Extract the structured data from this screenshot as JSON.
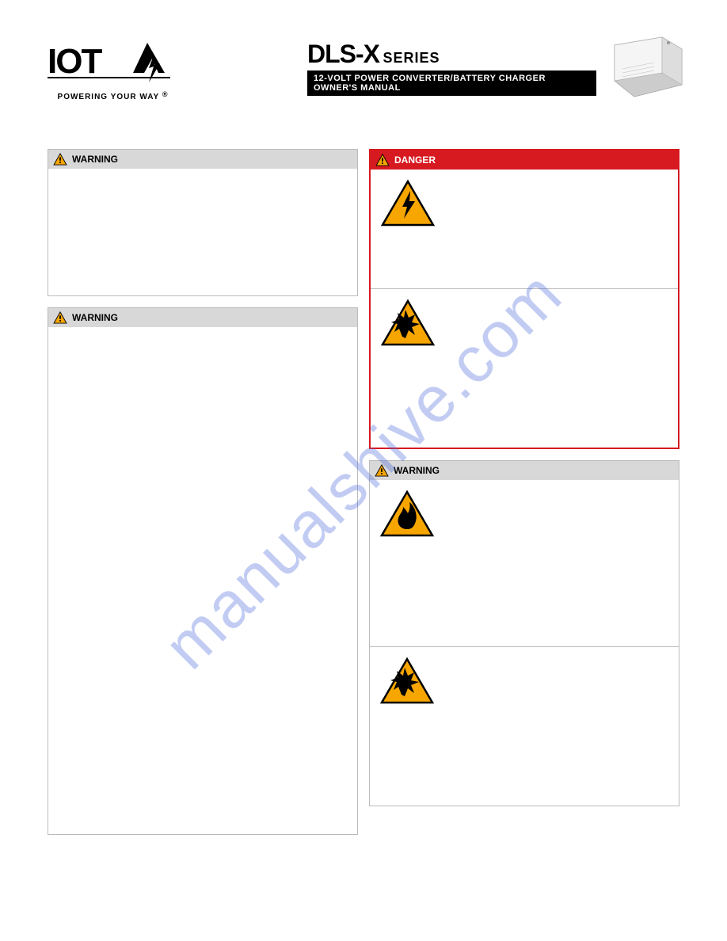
{
  "header": {
    "brand_name": "IOTA",
    "brand_tagline": "POWERING YOUR WAY",
    "registered_mark": "®",
    "product_title": "DLS-X",
    "product_series": "SERIES",
    "subtitle_line1": "12-VOLT POWER CONVERTER/BATTERY CHARGER",
    "subtitle_line2": "OWNER'S MANUAL"
  },
  "watermark": "manualshive.com",
  "boxes": {
    "left_warning_1": {
      "label": "WARNING"
    },
    "left_warning_2": {
      "label": "WARNING"
    },
    "danger": {
      "label": "DANGER",
      "section_electric": {
        "icon_name": "electric-shock"
      },
      "section_explosion": {
        "icon_name": "explosion"
      }
    },
    "right_warning": {
      "label": "WARNING",
      "section_fire": {
        "icon_name": "fire"
      },
      "section_explosion": {
        "icon_name": "explosion"
      }
    }
  },
  "colors": {
    "danger_red": "#d71920",
    "warning_orange": "#f7a600",
    "header_gray": "#d8d8d8"
  }
}
